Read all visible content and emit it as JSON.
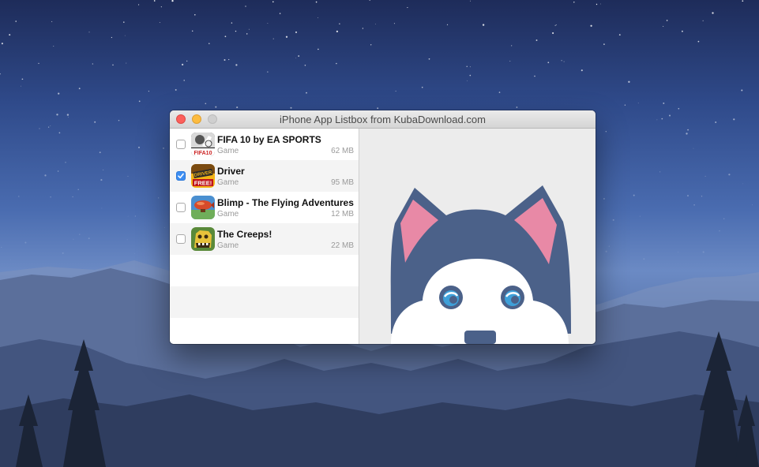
{
  "window": {
    "title": "iPhone App Listbox from KubaDownload.com"
  },
  "apps": [
    {
      "name": "FIFA 10 by EA SPORTS",
      "category": "Game",
      "size": "62 MB",
      "checked": false,
      "icon": "fifa-icon"
    },
    {
      "name": "Driver",
      "category": "Game",
      "size": "95 MB",
      "checked": true,
      "icon": "driver-icon"
    },
    {
      "name": "Blimp - The Flying Adventures",
      "category": "Game",
      "size": "12 MB",
      "checked": false,
      "icon": "blimp-icon"
    },
    {
      "name": "The Creeps!",
      "category": "Game",
      "size": "22 MB",
      "checked": false,
      "icon": "creeps-icon"
    }
  ],
  "icon_text": {
    "fifa": "FIFA10",
    "driver_top": "DRIVER",
    "driver_bottom": "FREE!"
  },
  "colors": {
    "checkbox_accent": "#3d8ef2",
    "husky_fur": "#4b6189",
    "husky_ear_inner": "#e889a6",
    "husky_eye": "#3ea0d9",
    "pane_background": "#ececec"
  }
}
